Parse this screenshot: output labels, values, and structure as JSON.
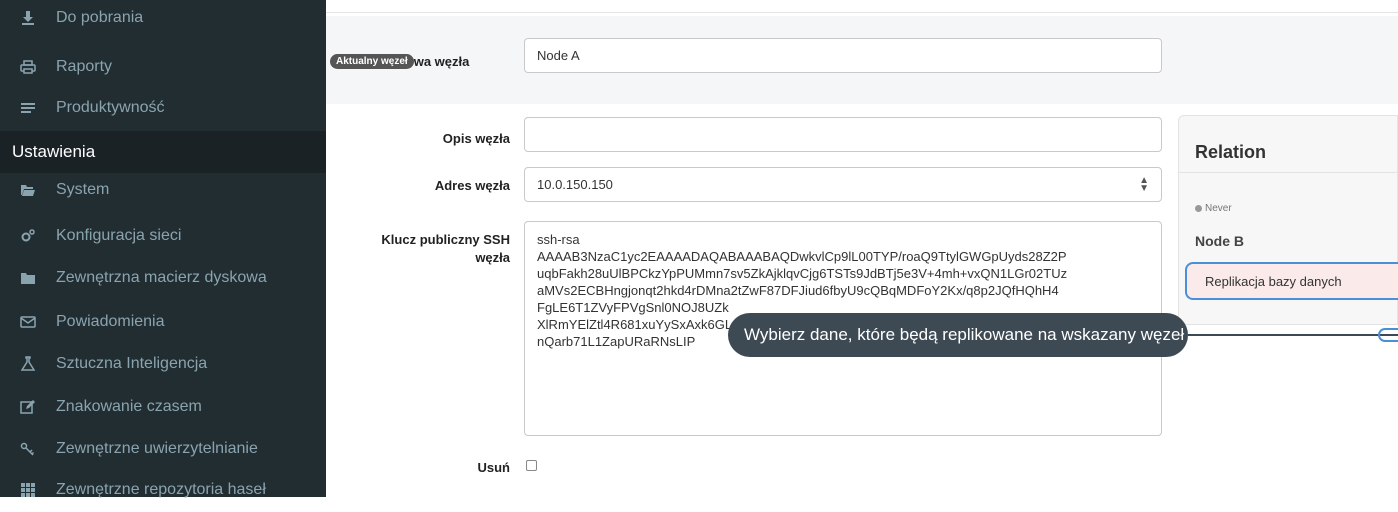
{
  "sidebar": {
    "items": [
      {
        "label": "Do pobrania",
        "icon": "download-icon"
      },
      {
        "label": "Raporty",
        "icon": "printer-icon"
      },
      {
        "label": "Produktywność",
        "icon": "list-icon"
      },
      {
        "label": "System",
        "icon": "folder-open-icon"
      },
      {
        "label": "Konfiguracja sieci",
        "icon": "gears-icon"
      },
      {
        "label": "Zewnętrzna macierz dyskowa",
        "icon": "folder-icon"
      },
      {
        "label": "Powiadomienia",
        "icon": "envelope-icon"
      },
      {
        "label": "Sztuczna Inteligencja",
        "icon": "flask-icon"
      },
      {
        "label": "Znakowanie czasem",
        "icon": "edit-icon"
      },
      {
        "label": "Zewnętrzne uwierzytelnianie",
        "icon": "key-icon"
      },
      {
        "label": "Zewnętrzne repozytoria haseł",
        "icon": "grid-icon"
      }
    ],
    "section_title": "Ustawienia"
  },
  "form": {
    "name_badge": "Aktualny węzeł",
    "name_label": "wa węzła",
    "name_value": "Node A",
    "desc_label": "Opis węzła",
    "desc_value": "",
    "addr_label": "Adres węzła",
    "addr_value": "10.0.150.150",
    "ssh_label_1": "Klucz publiczny SSH",
    "ssh_label_2": "węzła",
    "ssh_value": "ssh-rsa\nAAAAB3NzaC1yc2EAAAADAQABAAABAQDwkvlCp9lL00TYP/roaQ9TtylGWGpUyds28Z2P\nuqbFakh28uUlBPCkzYpPUMmn7sv5ZkAjklqvCjg6TSTs9JdBTj5e3V+4mh+vxQN1LGr02TUz\naMVs2ECBHngjonqt2hkd4rDMna2tZwF87DFJiud6fbyU9cQBqMDFoY2Kx/q8p2JQfHQhH4\nFgLE6T1ZVyFPVgSnl0NOJ8UZk\nXlRmYElZtl4R681xuYySxAxk6GL\nnQarb71L1ZapURaRNsLIP",
    "delete_label": "Usuń"
  },
  "panel": {
    "title": "Relation",
    "status": "Never",
    "node": "Node B",
    "select_value": "Replikacja bazy danych"
  },
  "tooltip": {
    "text": "Wybierz dane, które będą replikowane na wskazany węzeł"
  },
  "colors": {
    "sidebar_bg": "#222d32",
    "sidebar_text": "#8aa4af",
    "tooltip_bg": "#3d4a54",
    "highlight_border": "#4a90d9"
  }
}
